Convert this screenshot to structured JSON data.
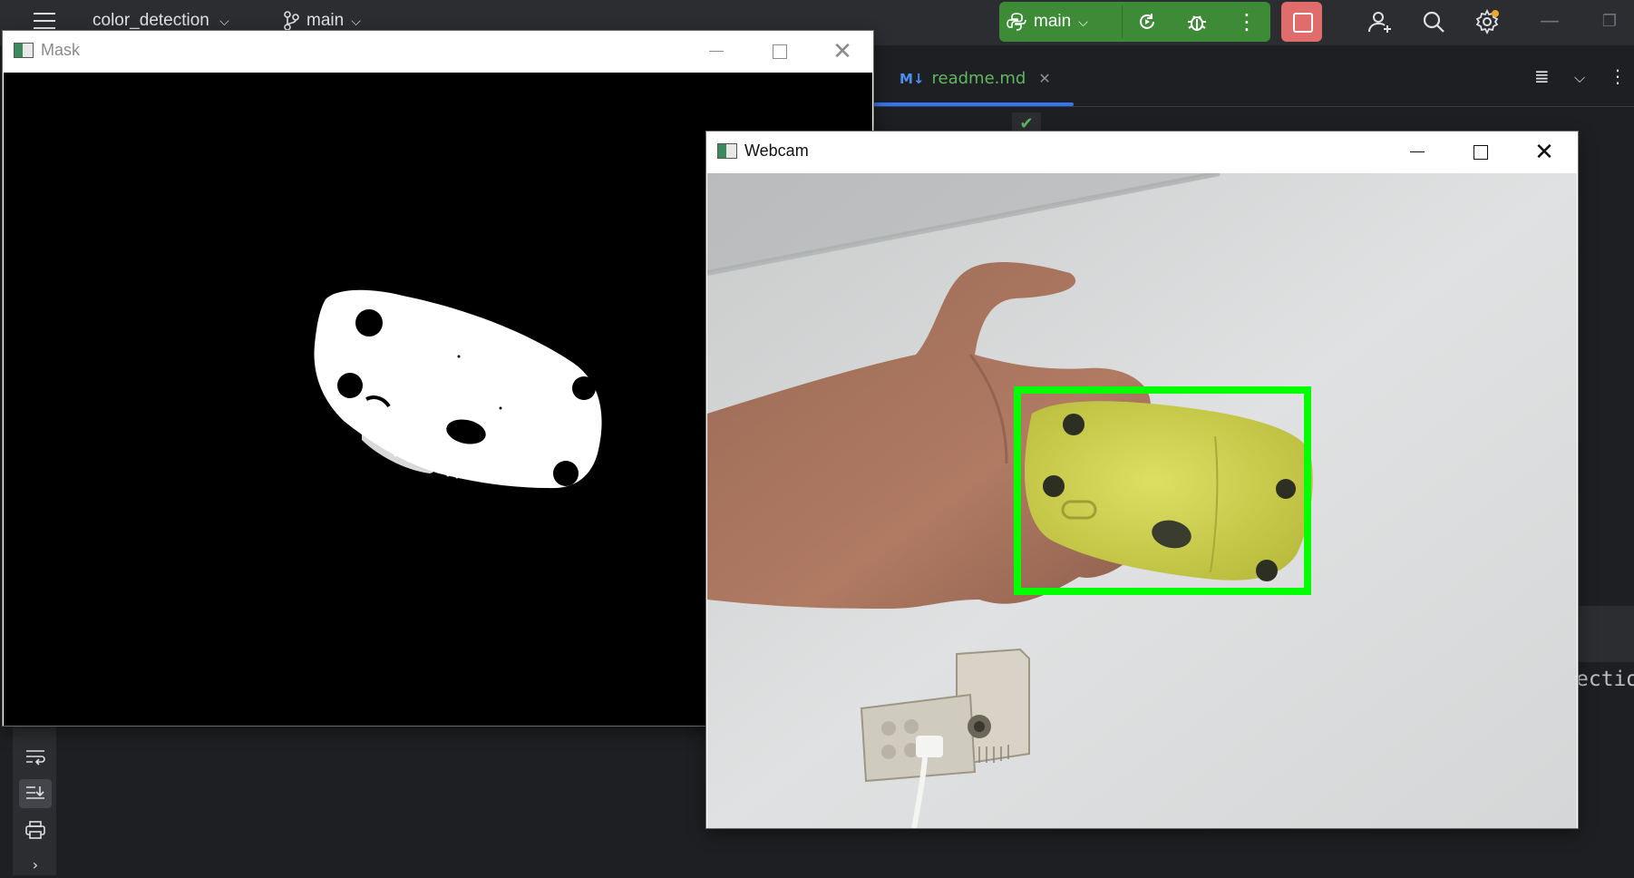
{
  "ide": {
    "project_name": "color_detection",
    "branch": "main",
    "run_config": "main",
    "editor_tab": {
      "badge": "M↓",
      "label": "readme.md"
    },
    "console_fragment": "ectio"
  },
  "windows": {
    "mask": {
      "title": "Mask"
    },
    "webcam": {
      "title": "Webcam"
    }
  },
  "colors": {
    "ide_bg": "#1e1f22",
    "ide_toolbar": "#2b2d30",
    "run_green": "#3d8b37",
    "stop_red": "#e06c6c",
    "detection_box": "#00ff00",
    "mouse_yellow": "#d4d94a"
  },
  "icons": {
    "toolbar": [
      "hamburger-menu-icon",
      "branch-icon",
      "python-icon",
      "rerun-icon",
      "debug-icon",
      "more-vertical-icon",
      "stop-icon",
      "add-user-icon",
      "search-icon",
      "settings-icon"
    ],
    "gutter": [
      "soft-wrap-icon",
      "scroll-to-end-icon",
      "print-icon",
      "expand-icon"
    ]
  }
}
